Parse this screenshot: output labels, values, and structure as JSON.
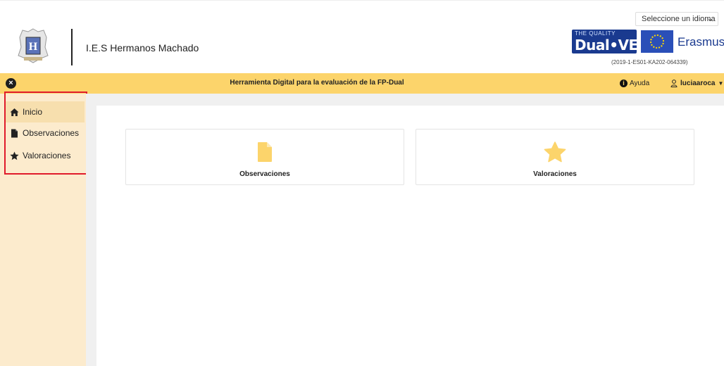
{
  "header": {
    "school_name": "I.E.S Hermanos Machado",
    "language_select": "Seleccione un idioma",
    "dualvet_small": "THE QUALITY",
    "dualvet_big": "Dual•VET",
    "erasmus": "Erasmus+",
    "project_code": "(2019-1-ES01-KA202-064339)"
  },
  "topbar": {
    "title": "Herramienta Digital para la evaluación de la FP-Dual",
    "help_label": "Ayuda",
    "username": "luciaaroca"
  },
  "sidebar": {
    "items": [
      {
        "label": "Inicio",
        "icon": "home-icon",
        "active": true
      },
      {
        "label": "Observaciones",
        "icon": "file-icon",
        "active": false
      },
      {
        "label": "Valoraciones",
        "icon": "star-icon",
        "active": false
      }
    ]
  },
  "cards": [
    {
      "label": "Observaciones",
      "icon": "file-icon"
    },
    {
      "label": "Valoraciones",
      "icon": "star-icon"
    }
  ],
  "colors": {
    "accent": "#fcd46b",
    "sidebar_bg": "#fcebcd",
    "highlight_border": "#e01b2b",
    "icon_yellow": "#fcd46b"
  }
}
